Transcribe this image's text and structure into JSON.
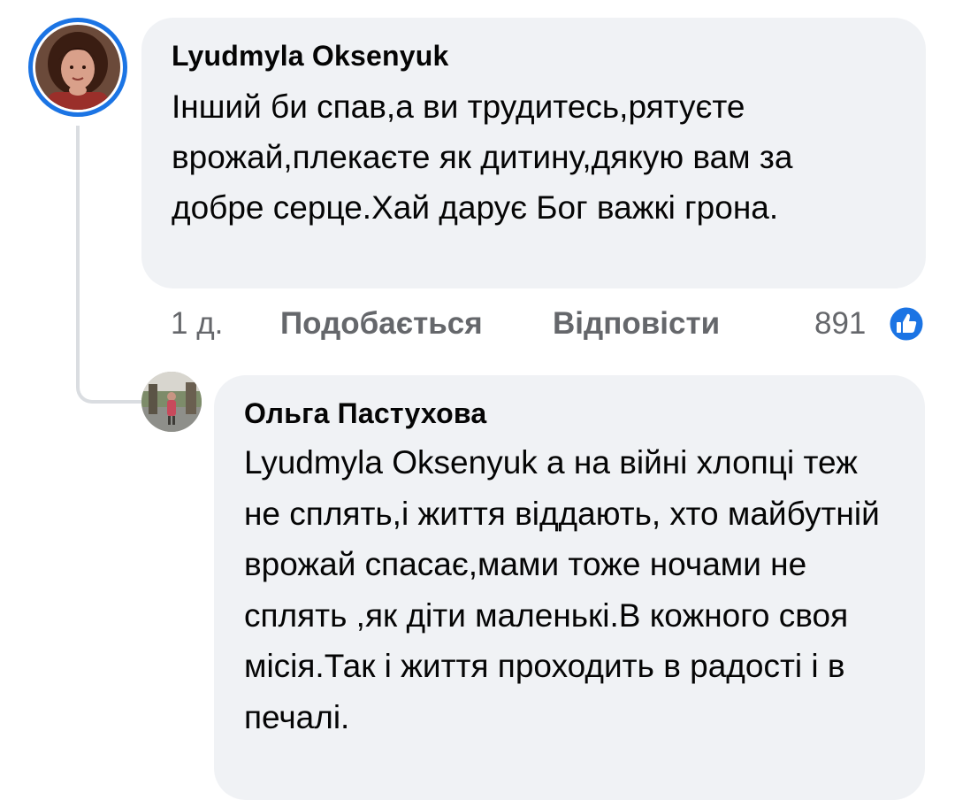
{
  "comments": [
    {
      "author": "Lyudmyla Oksenyuk",
      "text": "Інший би спав,а ви трудитесь,рятуєте врожай,плекаєте як дитину,дякую вам за добре серце.Хай дарує Бог важкі грона.",
      "time": "1 д.",
      "like_label": "Подобається",
      "reply_label": "Відповісти",
      "reaction_count": "891",
      "reaction_icon": "like-thumb-icon",
      "avatar_ring_color": "#1b74e4"
    },
    {
      "author": "Ольга Пастухова",
      "text": "Lyudmyla Oksenyuk а на війні хлопці теж не сплять,і життя віддають, хто майбутній врожай спасає,мами тоже ночами не сплять ,як діти маленькі.В кожного своя місія.Так і життя проходить в радості і  в печалі."
    }
  ],
  "colors": {
    "bubble": "#f0f2f5",
    "secondary_text": "#65676b",
    "accent": "#1b74e4",
    "thread_line": "#dadde1"
  }
}
